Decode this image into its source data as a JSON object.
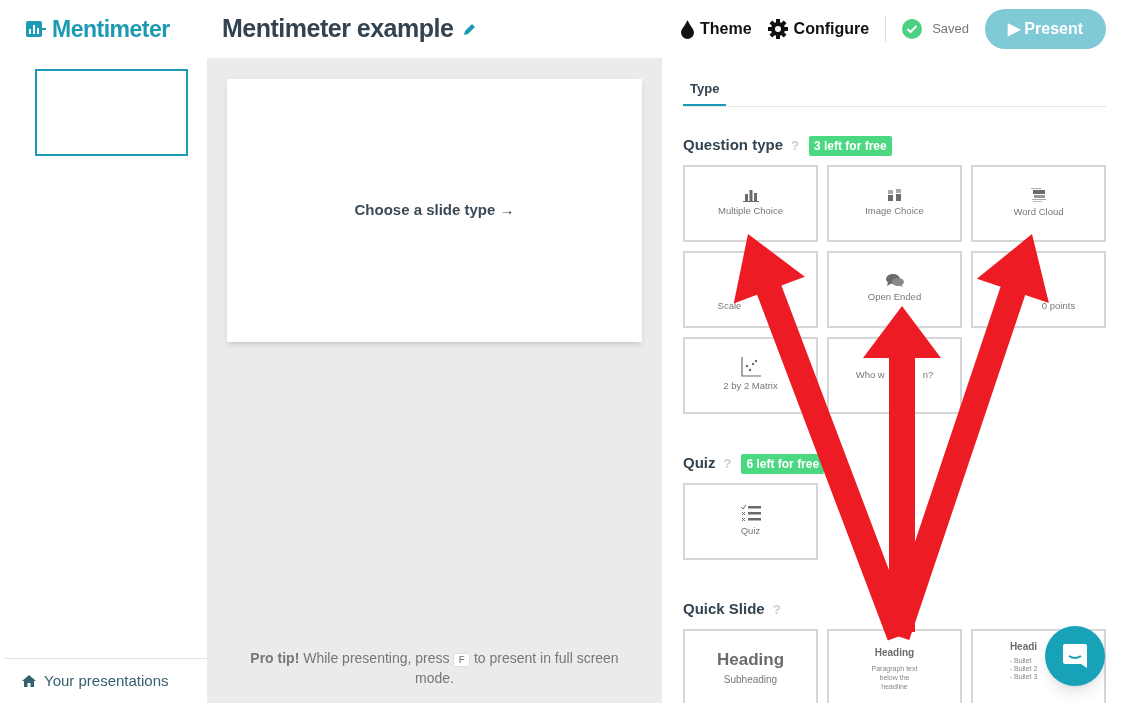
{
  "header": {
    "logo": "Mentimeter",
    "title": "Mentimeter example",
    "actions": [
      {
        "kind": "theme",
        "label": "Theme"
      },
      {
        "kind": "configure",
        "label": "Configure"
      }
    ],
    "status": "Saved",
    "present_button": "▶ Present"
  },
  "sidebar": {
    "slides": [
      {
        "selected": true
      }
    ],
    "footer_link": "Your presentations"
  },
  "canvas": {
    "prompt": "Choose a slide type →",
    "pro_tip": {
      "before": "**Pro tip!** While presenting, press",
      "key": "F",
      "after": "to present in full screen mode."
    }
  },
  "panel": {
    "tabs": [
      {
        "label": "Type",
        "selected": true
      }
    ],
    "sections": [
      {
        "title": "Question type",
        "help": "?",
        "badge": "3 left for free",
        "options": [
          {
            "kind": "bars",
            "label": [
              "Multiple Choice"
            ]
          },
          {
            "kind": "image",
            "label": [
              "Image Choice"
            ]
          },
          {
            "kind": "cloud",
            "label": [
              "Word Cloud"
            ]
          },
          {
            "kind": "scale",
            "label": [
              "Scale"
            ]
          },
          {
            "kind": "bubbles",
            "label": [
              "Open Ended"
            ]
          },
          {
            "kind": "points",
            "label": [
              "0 points"
            ]
          },
          {
            "kind": "matrix",
            "label": [
              "2 by 2 Matrix"
            ]
          },
          {
            "kind": "none",
            "label": [
              "Who w",
              "n?"
            ]
          }
        ]
      },
      {
        "title": "Quiz",
        "help": "?",
        "badge": "6 left for free",
        "options": [
          {
            "kind": "quiz",
            "label": [
              "Quiz"
            ]
          }
        ]
      },
      {
        "title": "Quick Slide",
        "help": "?",
        "options": [
          {
            "kind": "heading",
            "heading": "Heading",
            "lines": [
              "Subheading"
            ]
          },
          {
            "kind": "paragraph",
            "heading": "Heading",
            "lines": [
              "Paragraph text below the headline"
            ]
          },
          {
            "kind": "bullets",
            "heading": "Headi",
            "lines": [
              "- Bullet",
              "- Bullet 2",
              "- Bullet 3"
            ]
          }
        ]
      }
    ]
  }
}
